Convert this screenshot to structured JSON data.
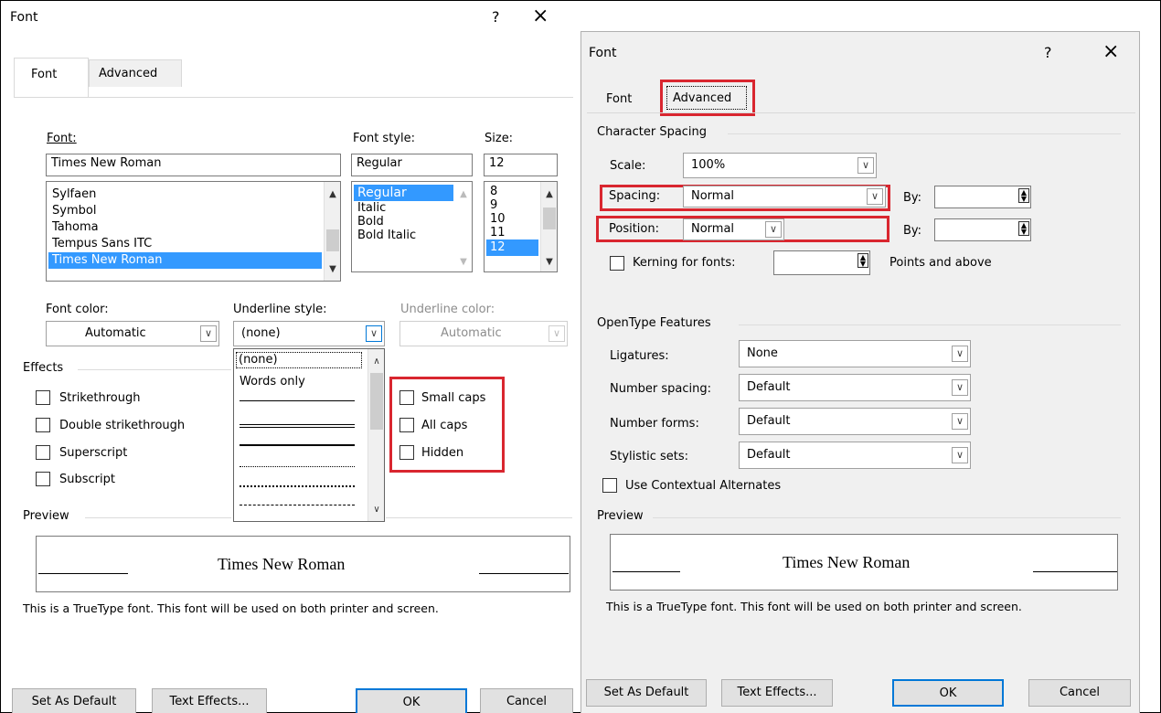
{
  "left": {
    "title": "Font",
    "help": "?",
    "close": "×",
    "tabs": [
      "Font",
      "Advanced"
    ],
    "font_label": "Font:",
    "font_value": "Times New Roman",
    "font_list": [
      "Sylfaen",
      "Symbol",
      "Tahoma",
      "Tempus Sans ITC",
      "Times New Roman"
    ],
    "style_label": "Font style:",
    "style_value": "Regular",
    "style_list": [
      "Regular",
      "Italic",
      "Bold",
      "Bold Italic"
    ],
    "size_label": "Size:",
    "size_value": "12",
    "size_list": [
      "8",
      "9",
      "10",
      "11",
      "12"
    ],
    "font_color_label": "Font color:",
    "font_color_value": "Automatic",
    "underline_style_label": "Underline style:",
    "underline_style_value": "(none)",
    "underline_color_label": "Underline color:",
    "underline_color_value": "Automatic",
    "underline_options": [
      "(none)",
      "Words only"
    ],
    "effects_label": "Effects",
    "effects": [
      "Strikethrough",
      "Double strikethrough",
      "Superscript",
      "Subscript"
    ],
    "effects_right": [
      "Small caps",
      "All caps",
      "Hidden"
    ],
    "preview_label": "Preview",
    "preview_text": "Times New Roman",
    "info": "This is a TrueType font. This font will be used on both printer and screen.",
    "buttons": {
      "set_default": "Set As Default",
      "text_effects": "Text Effects...",
      "ok": "OK",
      "cancel": "Cancel"
    }
  },
  "right": {
    "title": "Font",
    "help": "?",
    "close": "×",
    "tabs": [
      "Font",
      "Advanced"
    ],
    "char_spacing_label": "Character Spacing",
    "scale_label": "Scale:",
    "scale_value": "100%",
    "spacing_label": "Spacing:",
    "spacing_value": "Normal",
    "by_label": "By:",
    "position_label": "Position:",
    "position_value": "Normal",
    "kerning_label": "Kerning for fonts:",
    "points_label": "Points and above",
    "opentype_label": "OpenType Features",
    "ligatures_label": "Ligatures:",
    "ligatures_value": "None",
    "num_spacing_label": "Number spacing:",
    "num_spacing_value": "Default",
    "num_forms_label": "Number forms:",
    "num_forms_value": "Default",
    "stylistic_label": "Stylistic sets:",
    "stylistic_value": "Default",
    "contextual_label": "Use Contextual Alternates",
    "preview_label": "Preview",
    "preview_text": "Times New Roman",
    "info": "This is a TrueType font. This font will be used on both printer and screen.",
    "buttons": {
      "set_default": "Set As Default",
      "text_effects": "Text Effects...",
      "ok": "OK",
      "cancel": "Cancel"
    }
  },
  "colors": {
    "highlight": "#d9262f",
    "selection": "#3399ff",
    "ok_border": "#0078d7"
  }
}
